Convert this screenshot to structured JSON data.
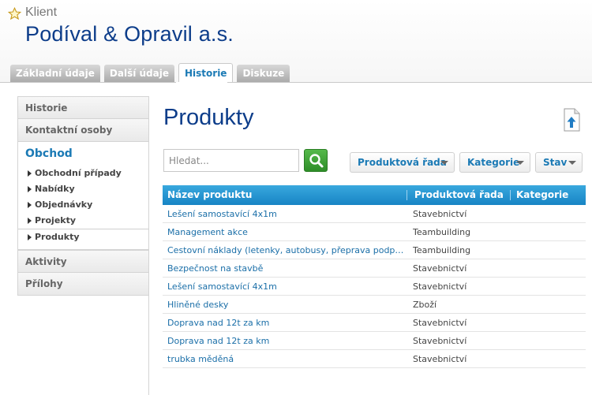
{
  "header": {
    "entity_type": "Klient",
    "company_name": "Podíval & Opravil a.s."
  },
  "tabs": [
    {
      "label": "Základní údaje",
      "active": false
    },
    {
      "label": "Další údaje",
      "active": false
    },
    {
      "label": "Historie",
      "active": true
    },
    {
      "label": "Diskuze",
      "active": false
    }
  ],
  "sidebar": {
    "top_items": [
      "Historie",
      "Kontaktní osoby"
    ],
    "active_section": {
      "title": "Obchod",
      "items": [
        "Obchodní případy",
        "Nabídky",
        "Objednávky",
        "Projekty",
        "Produkty"
      ]
    },
    "bottom_items": [
      "Aktivity",
      "Přílohy"
    ]
  },
  "main": {
    "title": "Produkty",
    "search": {
      "placeholder": "Hledat...",
      "value": ""
    },
    "filters": [
      "Produktová řada",
      "Kategorie",
      "Stav"
    ]
  },
  "table": {
    "columns": [
      "Název produktu",
      "Produktová řada",
      "Kategorie"
    ],
    "rows": [
      {
        "name": "Lešení samostavící 4x1m",
        "line": "Stavebnictví",
        "category": ""
      },
      {
        "name": "Management akce",
        "line": "Teambuilding",
        "category": ""
      },
      {
        "name": "Cestovní náklady (letenky, autobusy, přeprava podpůrného ...",
        "line": "Teambuilding",
        "category": ""
      },
      {
        "name": "Bezpečnost na stavbě",
        "line": "Stavebnictví",
        "category": ""
      },
      {
        "name": "Lešení samostavící 4x1m",
        "line": "Stavebnictví",
        "category": ""
      },
      {
        "name": "Hliněné desky",
        "line": "Zboží",
        "category": ""
      },
      {
        "name": "Doprava nad 12t za km",
        "line": "Stavebnictví",
        "category": ""
      },
      {
        "name": "Doprava nad 12t za km",
        "line": "Stavebnictví",
        "category": ""
      },
      {
        "name": "trubka měděná",
        "line": "Stavebnictví",
        "category": ""
      }
    ]
  },
  "colors": {
    "accent_blue": "#1b7ab5",
    "title_navy": "#0d3d8a",
    "search_green": "#3aa033",
    "table_header": "#2596d3"
  },
  "icons": {
    "favorite": "star-icon",
    "export": "export-icon",
    "search": "magnifier-icon"
  }
}
